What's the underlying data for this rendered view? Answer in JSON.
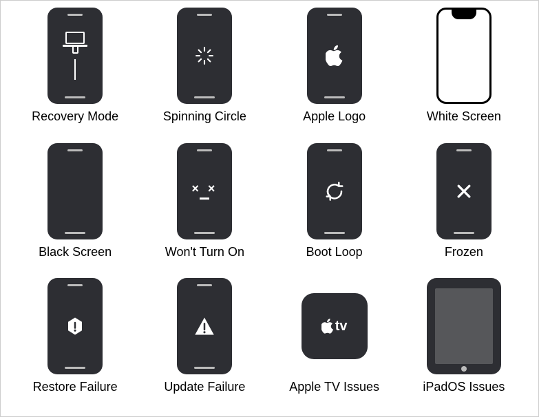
{
  "items": [
    {
      "id": "recovery-mode",
      "label": "Recovery Mode",
      "kind": "phone",
      "icon": "recovery"
    },
    {
      "id": "spinning-circle",
      "label": "Spinning Circle",
      "kind": "phone",
      "icon": "spinner"
    },
    {
      "id": "apple-logo",
      "label": "Apple Logo",
      "kind": "phone",
      "icon": "apple"
    },
    {
      "id": "white-screen",
      "label": "White Screen",
      "kind": "phone-white",
      "icon": "none"
    },
    {
      "id": "black-screen",
      "label": "Black Screen",
      "kind": "phone",
      "icon": "none"
    },
    {
      "id": "wont-turn-on",
      "label": "Won't Turn On",
      "kind": "phone",
      "icon": "dead-face"
    },
    {
      "id": "boot-loop",
      "label": "Boot Loop",
      "kind": "phone",
      "icon": "loop"
    },
    {
      "id": "frozen",
      "label": "Frozen",
      "kind": "phone",
      "icon": "cross"
    },
    {
      "id": "restore-failure",
      "label": "Restore Failure",
      "kind": "phone",
      "icon": "gear-alert"
    },
    {
      "id": "update-failure",
      "label": "Update Failure",
      "kind": "phone",
      "icon": "triangle-alert"
    },
    {
      "id": "apple-tv-issues",
      "label": "Apple TV Issues",
      "kind": "appletv",
      "icon": "appletv-logo"
    },
    {
      "id": "ipados-issues",
      "label": "iPadOS Issues",
      "kind": "ipad",
      "icon": "none"
    }
  ]
}
